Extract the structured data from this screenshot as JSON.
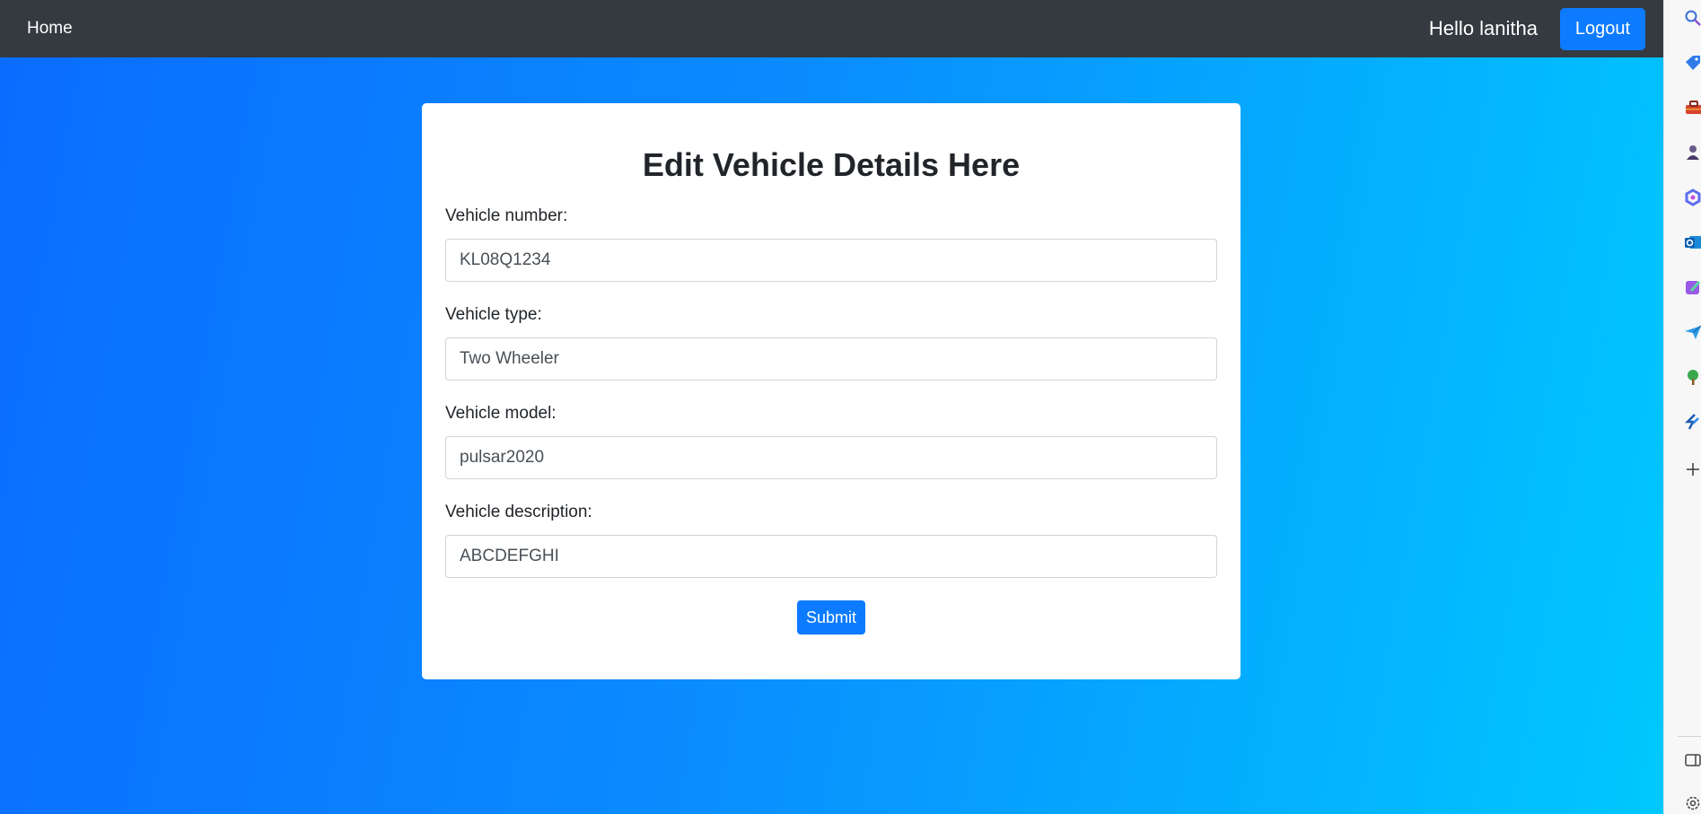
{
  "navbar": {
    "home_label": "Home",
    "greeting": "Hello lanitha",
    "logout_label": "Logout"
  },
  "form": {
    "title": "Edit Vehicle Details Here",
    "fields": [
      {
        "label": "Vehicle number:",
        "value": "KL08Q1234"
      },
      {
        "label": "Vehicle type:",
        "value": "Two Wheeler"
      },
      {
        "label": "Vehicle model:",
        "value": "pulsar2020"
      },
      {
        "label": "Vehicle description:",
        "value": "ABCDEFGHI"
      }
    ],
    "submit_label": "Submit"
  },
  "sidebar": {
    "icons": [
      "search-icon",
      "tag-icon",
      "toolbox-icon",
      "person-icon",
      "copilot-icon",
      "outlook-icon",
      "designer-icon",
      "send-icon",
      "tree-icon",
      "app-icon",
      "add-icon",
      "split-screen-icon",
      "settings-icon"
    ]
  },
  "colors": {
    "navbar": "#343a40",
    "primary_button": "#0d7bff",
    "gradient_start": "#0a6cff",
    "gradient_end": "#00c8ff"
  }
}
